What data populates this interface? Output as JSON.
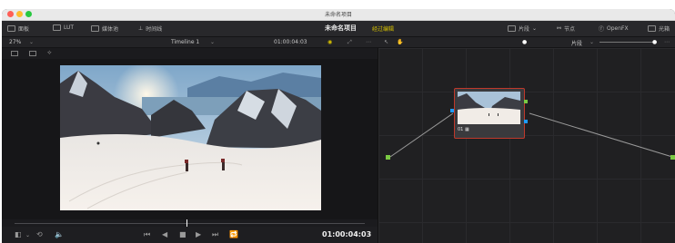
{
  "window": {
    "title": "未命名项目"
  },
  "toolbar": {
    "media_pool_label": "面板",
    "lut_label": "LUT",
    "media_label": "媒体池",
    "timeline_label": "时间线",
    "project_name": "未命名项目",
    "project_status": "经过编辑",
    "clips_label": "片段",
    "nodes_label": "节点",
    "openfx_label": "OpenFX",
    "lightbox_label": "光箱"
  },
  "subbar": {
    "zoom": "27%",
    "timeline_name": "Timeline 1",
    "timecode": "01:00:04:03",
    "clip_mode": "片段"
  },
  "node": {
    "label": "01"
  },
  "transport": {
    "timecode": "01:00:04:03"
  },
  "colors": {
    "accent_yellow": "#d8c200",
    "node_border": "#c0392b",
    "port_green": "#7ac943",
    "port_blue": "#1e9bff"
  }
}
